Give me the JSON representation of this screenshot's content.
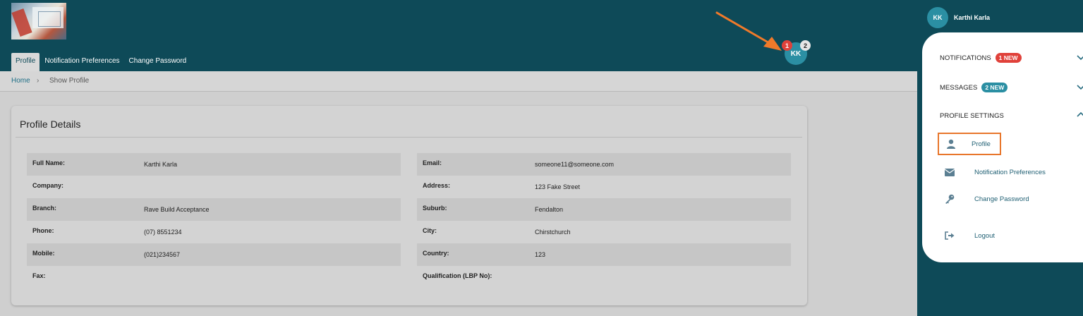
{
  "header": {
    "tabs": [
      "Profile",
      "Notification Preferences",
      "Change Password"
    ],
    "active_tab": 0,
    "avatar_initials": "KK",
    "notification_badge": "1",
    "message_badge": "2"
  },
  "breadcrumb": {
    "home": "Home",
    "separator": "›",
    "current": "Show Profile"
  },
  "profile": {
    "title": "Profile Details",
    "left": [
      {
        "label": "Full Name:",
        "value": "Karthi Karla"
      },
      {
        "label": "Company:",
        "value": ""
      },
      {
        "label": "Branch:",
        "value": "Rave Build Acceptance"
      },
      {
        "label": "Phone:",
        "value": "(07) 8551234"
      },
      {
        "label": "Mobile:",
        "value": "(021)234567"
      },
      {
        "label": "Fax:",
        "value": ""
      }
    ],
    "right": [
      {
        "label": "Email:",
        "value": "someone11@someone.com"
      },
      {
        "label": "Address:",
        "value": "123 Fake Street"
      },
      {
        "label": "Suburb:",
        "value": "Fendalton"
      },
      {
        "label": "City:",
        "value": "Chirstchurch"
      },
      {
        "label": "Country:",
        "value": "123"
      },
      {
        "label": "Qualification (LBP No):",
        "value": ""
      }
    ]
  },
  "drawer": {
    "avatar_initials": "KK",
    "user_name": "Karthi Karla",
    "notifications": {
      "label": "NOTIFICATIONS",
      "badge": "1 NEW"
    },
    "messages": {
      "label": "MESSAGES",
      "badge": "2 NEW"
    },
    "profile_settings": {
      "label": "PROFILE SETTINGS"
    },
    "items": {
      "profile": "Profile",
      "notification_preferences": "Notification Preferences",
      "change_password": "Change Password",
      "logout": "Logout"
    }
  },
  "colors": {
    "header_bg": "#0e4a58",
    "accent_teal": "#2b8fa3",
    "badge_red": "#e0413a",
    "highlight_orange": "#e8762b"
  }
}
